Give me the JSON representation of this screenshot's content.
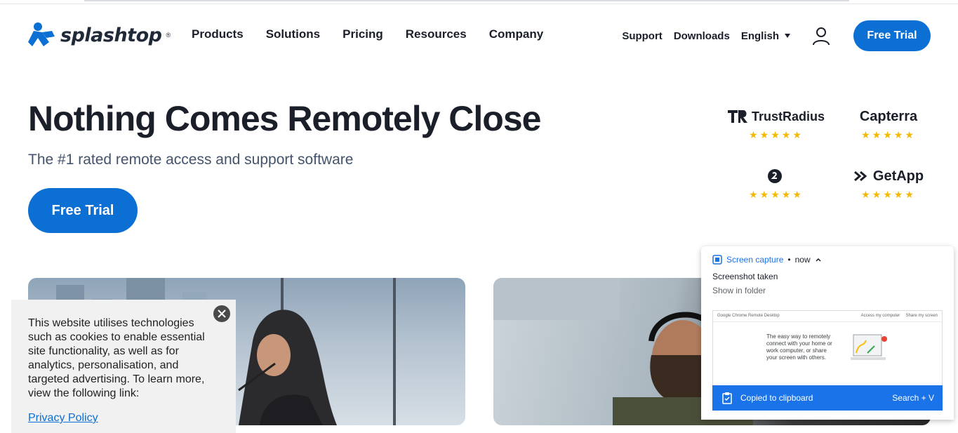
{
  "brand": {
    "logo_text": "splashtop",
    "logo_mark": "®",
    "accent": "#0b6fd3"
  },
  "nav": {
    "items": [
      {
        "label": "Products"
      },
      {
        "label": "Solutions"
      },
      {
        "label": "Pricing"
      },
      {
        "label": "Resources"
      },
      {
        "label": "Company"
      }
    ]
  },
  "utility": {
    "support": "Support",
    "downloads": "Downloads",
    "language": "English",
    "cta": "Free Trial"
  },
  "hero": {
    "title": "Nothing Comes Remotely Close",
    "subtitle": "The #1 rated remote access and support software",
    "cta": "Free Trial"
  },
  "ratings": [
    {
      "name": "TrustRadius",
      "stars": "★★★★★"
    },
    {
      "name": "Capterra",
      "stars": "★★★★★"
    },
    {
      "name": "",
      "stars": "★★★★★"
    },
    {
      "name": "GetApp",
      "stars": "★★★★★"
    }
  ],
  "cookie": {
    "text": "This website utilises technologies such as cookies to enable essential site functionality, as well as for analytics, personalisation, and targeted advertising. To learn more, view the following link:",
    "link": "Privacy Policy"
  },
  "notification": {
    "app": "Screen capture",
    "time": "now",
    "title": "Screenshot taken",
    "action": "Show in folder",
    "thumb_header": "Google Chrome Remote Desktop",
    "thumb_tab1": "Access my computer",
    "thumb_tab2": "Share my screen",
    "thumb_text": "The easy way to remotely connect with your home or work computer, or share your screen with others.",
    "footer_left": "Copied to clipboard",
    "footer_right": "Search + V"
  }
}
